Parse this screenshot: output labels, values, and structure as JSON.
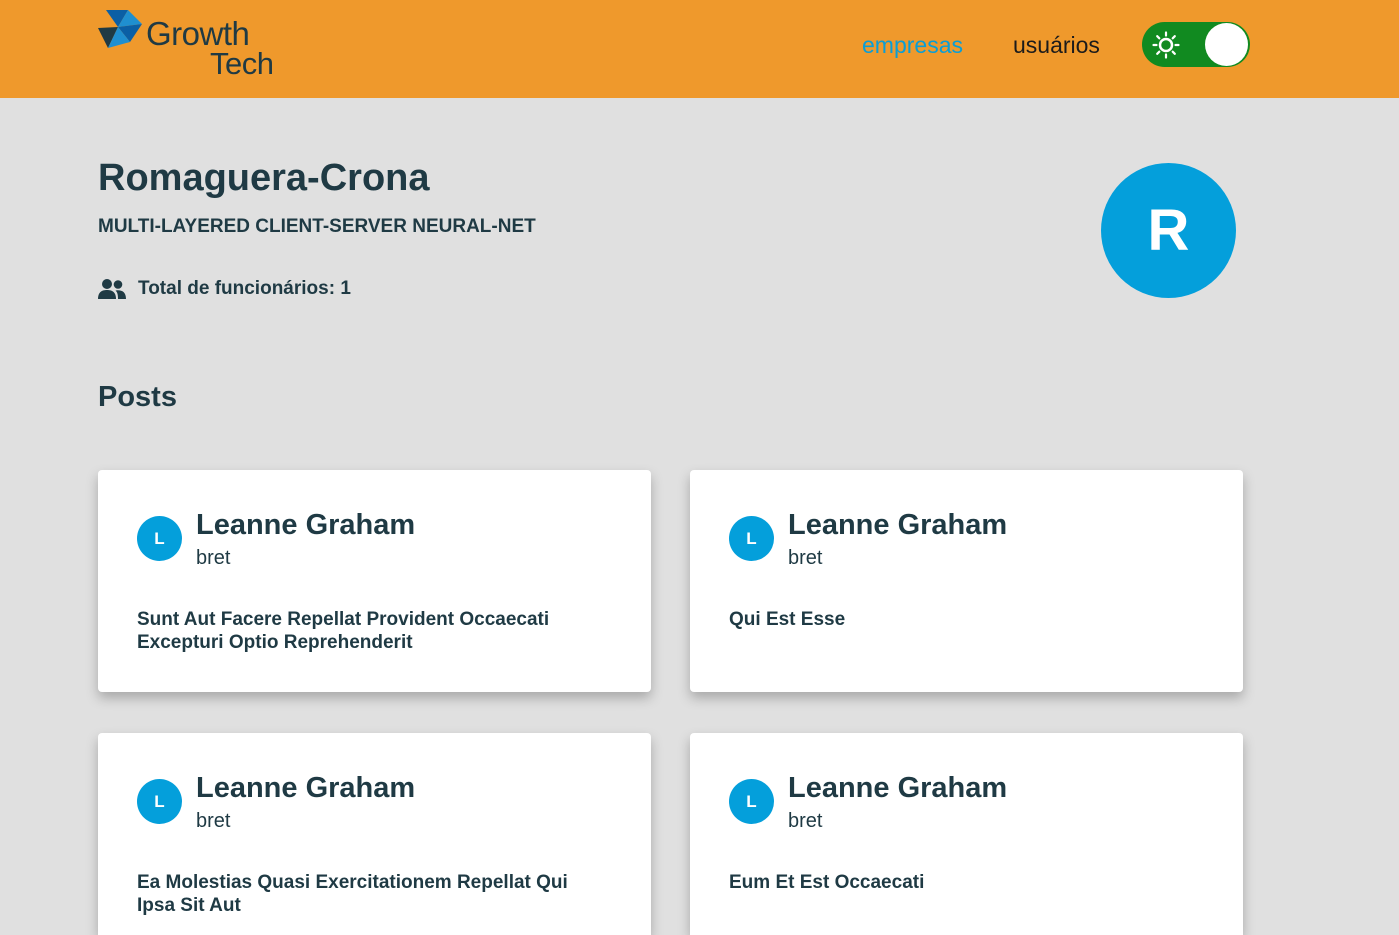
{
  "header": {
    "logo": {
      "word1": "Growth",
      "word2": "Tech"
    },
    "nav": [
      {
        "label": "empresas",
        "active": true
      },
      {
        "label": "usuários",
        "active": false
      }
    ],
    "theme_toggle": {
      "icon": "sun-icon",
      "state": "light"
    }
  },
  "company": {
    "name": "Romaguera-Crona",
    "catch_phrase": "MULTI-LAYERED CLIENT-SERVER NEURAL-NET",
    "employees_label": "Total de funcionários: 1",
    "avatar_letter": "R"
  },
  "posts": {
    "heading": "Posts",
    "items": [
      {
        "avatar_letter": "L",
        "author": "Leanne Graham",
        "username": "bret",
        "title": "Sunt Aut Facere Repellat Provident Occaecati Excepturi Optio Reprehenderit"
      },
      {
        "avatar_letter": "L",
        "author": "Leanne Graham",
        "username": "bret",
        "title": "Qui Est Esse"
      },
      {
        "avatar_letter": "L",
        "author": "Leanne Graham",
        "username": "bret",
        "title": "Ea Molestias Quasi Exercitationem Repellat Qui Ipsa Sit Aut"
      },
      {
        "avatar_letter": "L",
        "author": "Leanne Graham",
        "username": "bret",
        "title": "Eum Et Est Occaecati"
      }
    ]
  },
  "colors": {
    "header_bg": "#ef992c",
    "page_bg": "#e0e0e0",
    "accent_blue": "#049fdb",
    "nav_active": "#0a9ed6",
    "toggle_bg": "#118a20",
    "text_dark": "#1f3a44"
  }
}
